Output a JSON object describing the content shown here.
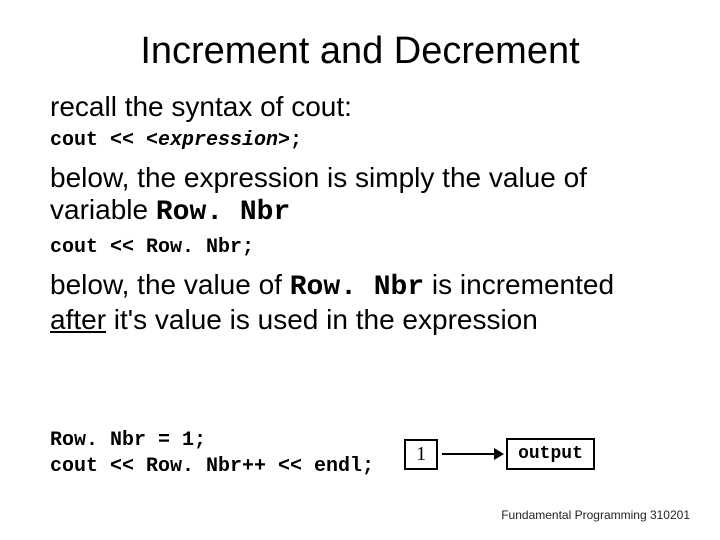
{
  "title": "Increment and Decrement",
  "p1": "recall the syntax of cout:",
  "code1_prefix": "cout << ",
  "code1_expr": "<expression>",
  "code1_suffix": ";",
  "p2_a": "below, the expression is simply the value of variable  ",
  "p2_code": "Row. Nbr",
  "code2": "cout << Row. Nbr;",
  "p3_a": "below, the value of ",
  "p3_code": "Row. Nbr",
  "p3_b": " is incremented ",
  "p3_after": "after",
  "p3_c": " it's value is used in the expression",
  "code3_line1": "Row. Nbr = 1;",
  "code3_line2": "cout << Row. Nbr++ << endl;",
  "box_value": "1",
  "box_label": "output",
  "footer": "Fundamental Programming 310201"
}
